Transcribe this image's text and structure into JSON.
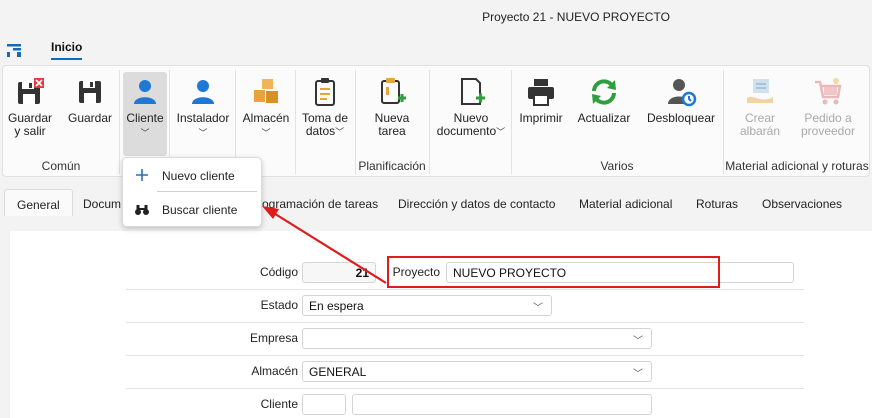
{
  "window": {
    "title": "Proyecto 21 - NUEVO PROYECTO"
  },
  "ribbon_tabs": {
    "active": "Inicio"
  },
  "ribbon": {
    "buttons": {
      "guardar_salir": "Guardar\ny salir",
      "guardar": "Guardar",
      "cliente": "Cliente",
      "instalador": "Instalador",
      "almacen": "Almacén",
      "toma_datos": "Toma de\ndatos",
      "nueva_tarea": "Nueva\ntarea",
      "nuevo_documento": "Nuevo\ndocumento",
      "imprimir": "Imprimir",
      "actualizar": "Actualizar",
      "desbloquear": "Desbloquear",
      "crear_albaran": "Crear\nalbarán",
      "pedido_proveedor": "Pedido a\nproveedor"
    },
    "groups": {
      "comun": "Común",
      "planificacion": "Planificación",
      "varios": "Varios",
      "material": "Material adicional y roturas"
    }
  },
  "cliente_menu": {
    "nuevo": "Nuevo cliente",
    "buscar": "Buscar cliente"
  },
  "form_tabs": {
    "general": "General",
    "documentos": "Docum",
    "programacion": "ogramación de tareas",
    "direccion": "Dirección y datos de contacto",
    "material": "Material adicional",
    "roturas": "Roturas",
    "observaciones": "Observaciones"
  },
  "form": {
    "codigo_label": "Código",
    "codigo_value": "21",
    "proyecto_label": "Proyecto",
    "proyecto_value": "NUEVO PROYECTO",
    "estado_label": "Estado",
    "estado_value": "En espera",
    "empresa_label": "Empresa",
    "empresa_value": "",
    "almacen_label": "Almacén",
    "almacen_value": "GENERAL",
    "cliente_label": "Cliente",
    "cliente_code": "",
    "cliente_name": ""
  },
  "colors": {
    "accent": "#0f6cbd",
    "highlight": "#e01b1b",
    "green": "#2e9e3f",
    "orange": "#e8a33b"
  }
}
